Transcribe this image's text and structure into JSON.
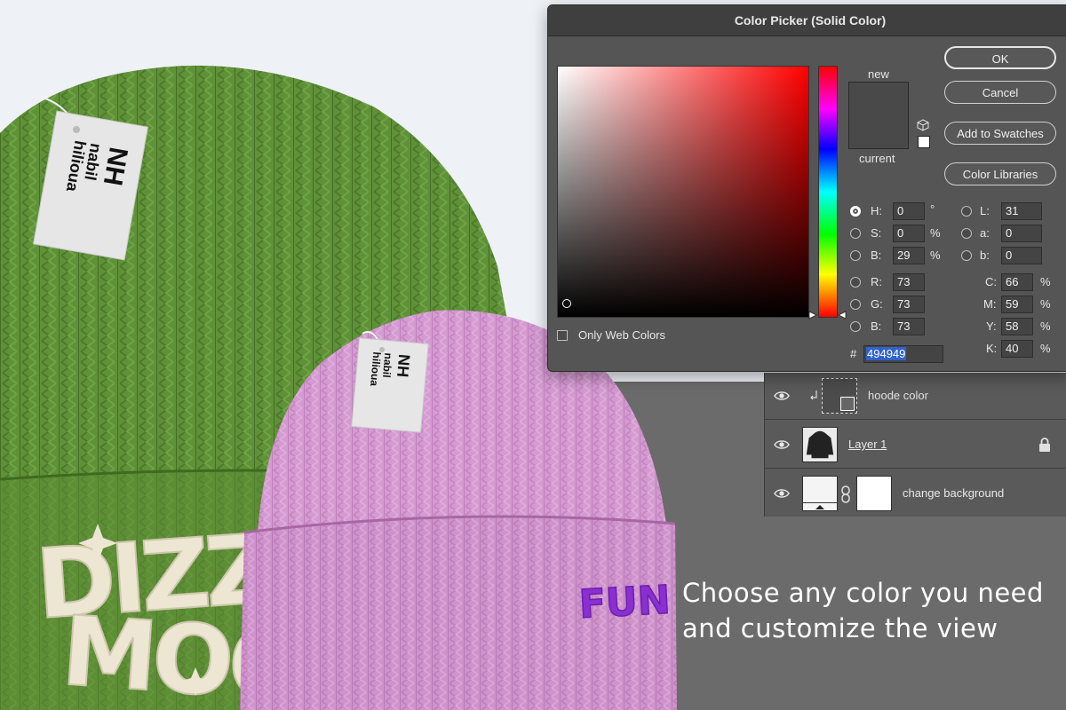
{
  "dialog": {
    "title": "Color Picker (Solid Color)",
    "new_label": "new",
    "current_label": "current",
    "new_color": "#494949",
    "current_color": "#494949",
    "buttons": {
      "ok": "OK",
      "cancel": "Cancel",
      "add_to_swatches": "Add to Swatches",
      "color_libraries": "Color Libraries"
    },
    "hsb": {
      "h_label": "H:",
      "h_value": "0",
      "h_unit": "°",
      "s_label": "S:",
      "s_value": "0",
      "s_unit": "%",
      "b_label": "B:",
      "b_value": "29",
      "b_unit": "%"
    },
    "rgb": {
      "r_label": "R:",
      "r_value": "73",
      "g_label": "G:",
      "g_value": "73",
      "b_label": "B:",
      "b_value": "73"
    },
    "lab": {
      "l_label": "L:",
      "l_value": "31",
      "a_label": "a:",
      "a_value": "0",
      "b_label": "b:",
      "b_value": "0"
    },
    "cmyk": {
      "c_label": "C:",
      "c_value": "66",
      "c_unit": "%",
      "m_label": "M:",
      "m_value": "59",
      "m_unit": "%",
      "y_label": "Y:",
      "y_value": "58",
      "y_unit": "%",
      "k_label": "K:",
      "k_value": "40",
      "k_unit": "%"
    },
    "hex_label": "#",
    "hex_value": "494949",
    "only_web_colors_label": "Only Web Colors",
    "only_web_colors_checked": false,
    "selected_mode": "H"
  },
  "layers": [
    {
      "name": "hoode color",
      "visible": true
    },
    {
      "name": "Layer 1",
      "visible": true,
      "locked": true
    },
    {
      "name": "change background",
      "visible": true
    }
  ],
  "tagline": {
    "line1": "Choose any color you need",
    "line2": "and customize the view"
  },
  "hats": {
    "green_hat": {
      "color": "#5f9138",
      "tag_text_1": "nabil",
      "tag_text_2": "hilioua",
      "embroidery": "DIZZY MOOD",
      "embroidery_color": "#ece6d3"
    },
    "pink_hat": {
      "color": "#d49ad1",
      "tag_text_1": "nabil",
      "tag_text_2": "hilioua",
      "embroidery": "FUN",
      "embroidery_color": "#8a2fd1"
    }
  }
}
